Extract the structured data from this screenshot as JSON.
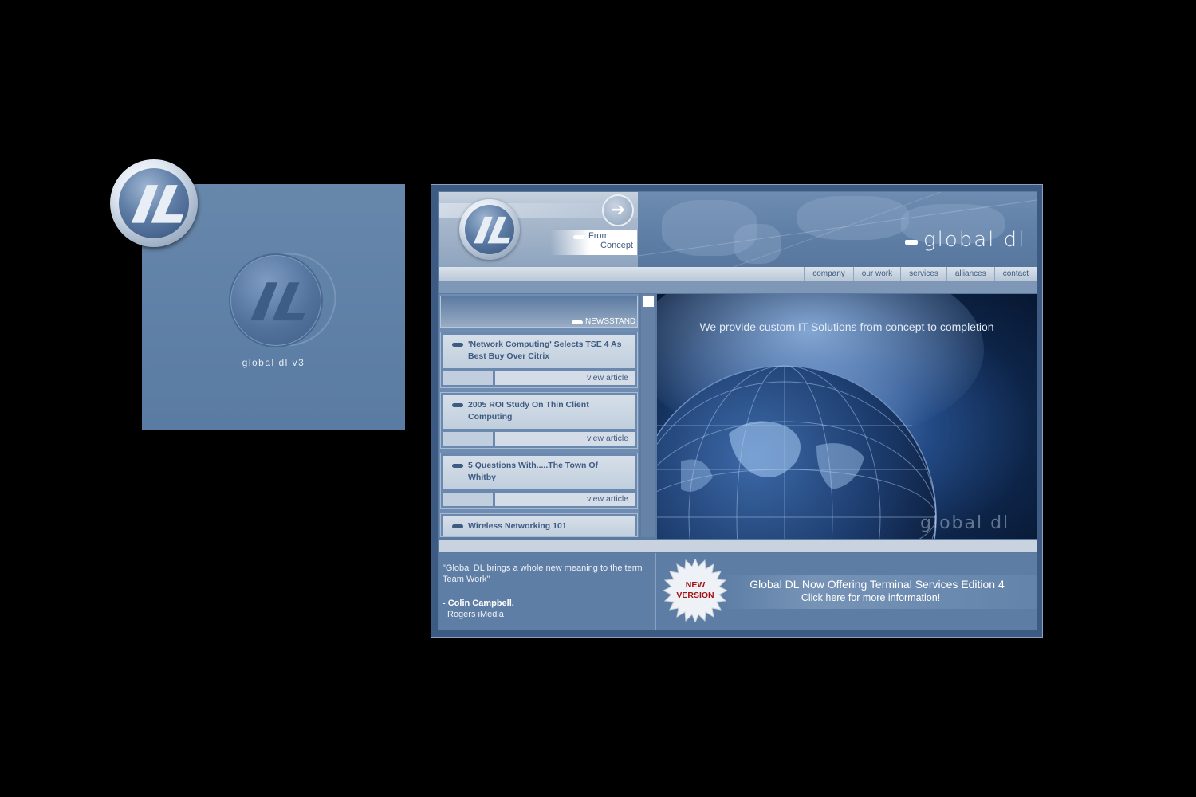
{
  "splash": {
    "caption": "global dl v3"
  },
  "header": {
    "tag_line_1": "From",
    "tag_line_2": "Concept",
    "brand": "global dl",
    "arrow_icon": "arrow-right-icon"
  },
  "nav": {
    "items": [
      "company",
      "our work",
      "services",
      "alliances",
      "contact"
    ]
  },
  "newsstand": {
    "label": "NEWSSTAND",
    "items": [
      {
        "title": "'Network Computing' Selects TSE 4 As Best Buy Over Citrix",
        "link": "view article"
      },
      {
        "title": "2005 ROI Study On Thin Client Computing",
        "link": "view article"
      },
      {
        "title": "5 Questions With.....The Town Of Whitby",
        "link": "view article"
      },
      {
        "title": "Wireless Networking 101"
      }
    ]
  },
  "hero": {
    "tagline": "We provide custom IT Solutions from concept to completion",
    "watermark": "global dl"
  },
  "quote": {
    "text": "\"Global DL brings a whole new meaning to the term Team Work\"",
    "author": "- Colin Campbell,",
    "company": "Rogers iMedia"
  },
  "promo": {
    "badge_line_1": "NEW",
    "badge_line_2": "VERSION",
    "title": "Global DL Now Offering Terminal Services Edition 4",
    "subtitle": "Click here for more information!"
  },
  "colors": {
    "background": "#000000",
    "panel_blue": "#5f80a6",
    "text_dark_blue": "#3e5b82",
    "badge_red": "#a21212"
  }
}
